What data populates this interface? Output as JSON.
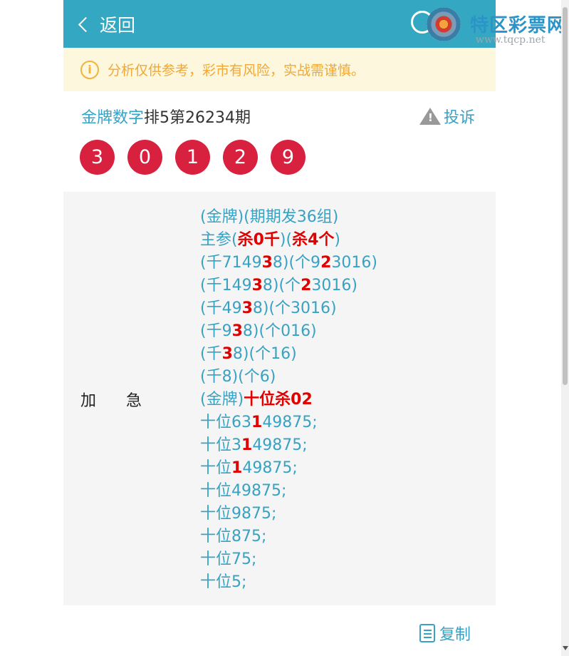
{
  "header": {
    "back_label": "返回"
  },
  "watermark": {
    "title": "特区彩票网",
    "url": "www.tqcp.net"
  },
  "notice": {
    "icon": "i",
    "text": "分析仅供参考，彩市有风险，实战需谨慎。"
  },
  "title": {
    "link": "金牌数字",
    "rest": "排5第26234期"
  },
  "complain_label": "投诉",
  "balls": [
    "3",
    "0",
    "1",
    "2",
    "9"
  ],
  "side_label": [
    "加",
    "急"
  ],
  "lines": [
    [
      {
        "t": "(金牌)(期期发36组)"
      }
    ],
    [
      {
        "t": "主参("
      },
      {
        "t": "杀0千",
        "h": 1
      },
      {
        "t": ")("
      },
      {
        "t": "杀4个",
        "h": 1
      },
      {
        "t": ")"
      }
    ],
    [
      {
        "t": "(千7149"
      },
      {
        "t": "3",
        "h": 1
      },
      {
        "t": "8)(个9"
      },
      {
        "t": "2",
        "h": 1
      },
      {
        "t": "3016)"
      }
    ],
    [
      {
        "t": "(千149"
      },
      {
        "t": "3",
        "h": 1
      },
      {
        "t": "8)(个"
      },
      {
        "t": "2",
        "h": 1
      },
      {
        "t": "3016)"
      }
    ],
    [
      {
        "t": "(千49"
      },
      {
        "t": "3",
        "h": 1
      },
      {
        "t": "8)(个3016)"
      }
    ],
    [
      {
        "t": "(千9"
      },
      {
        "t": "3",
        "h": 1
      },
      {
        "t": "8)(个016)"
      }
    ],
    [
      {
        "t": "(千"
      },
      {
        "t": "3",
        "h": 1
      },
      {
        "t": "8)(个16)"
      }
    ],
    [
      {
        "t": "(千8)(个6)"
      }
    ],
    [
      {
        "t": "(金牌)"
      },
      {
        "t": "十位杀02",
        "h": 1
      }
    ],
    [
      {
        "t": "十位63"
      },
      {
        "t": "1",
        "h": 1
      },
      {
        "t": "49875;"
      }
    ],
    [
      {
        "t": "十位3"
      },
      {
        "t": "1",
        "h": 1
      },
      {
        "t": "49875;"
      }
    ],
    [
      {
        "t": "十位"
      },
      {
        "t": "1",
        "h": 1
      },
      {
        "t": "49875;"
      }
    ],
    [
      {
        "t": "十位49875;"
      }
    ],
    [
      {
        "t": "十位9875;"
      }
    ],
    [
      {
        "t": "十位875;"
      }
    ],
    [
      {
        "t": "十位75;"
      }
    ],
    [
      {
        "t": "十位5;"
      }
    ]
  ],
  "copy_label": "复制"
}
